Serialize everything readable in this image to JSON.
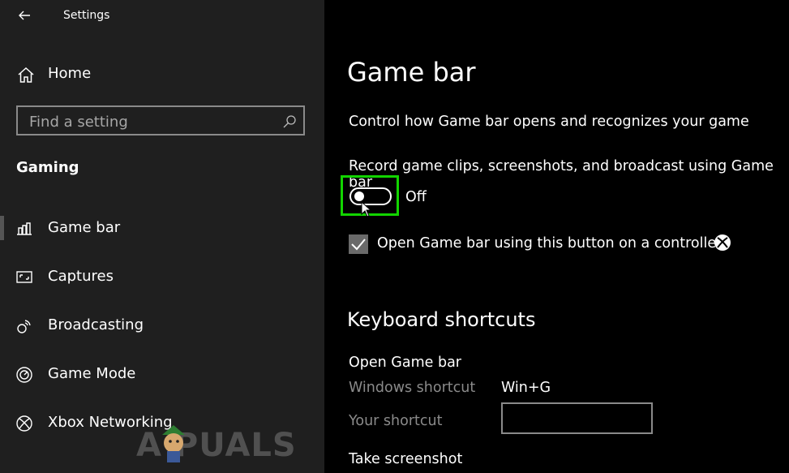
{
  "window": {
    "title": "Settings"
  },
  "sidebar": {
    "home_label": "Home",
    "search_placeholder": "Find a setting",
    "section_title": "Gaming",
    "items": [
      {
        "label": "Game bar",
        "icon": "game-bar-icon",
        "active": true
      },
      {
        "label": "Captures",
        "icon": "captures-icon",
        "active": false
      },
      {
        "label": "Broadcasting",
        "icon": "broadcasting-icon",
        "active": false
      },
      {
        "label": "Game Mode",
        "icon": "game-mode-icon",
        "active": false
      },
      {
        "label": "Xbox Networking",
        "icon": "xbox-icon",
        "active": false
      }
    ]
  },
  "main": {
    "title": "Game bar",
    "subtitle": "Control how Game bar opens and recognizes your game",
    "record_label": "Record game clips, screenshots, and broadcast using Game bar",
    "toggle_state": "Off",
    "controller_checkbox_label": "Open Game bar using this button on a controller:",
    "controller_checked": true,
    "shortcuts_title": "Keyboard shortcuts",
    "open_game_bar": "Open Game bar",
    "windows_shortcut_label": "Windows shortcut",
    "windows_shortcut_value": "Win+G",
    "your_shortcut_label": "Your shortcut",
    "your_shortcut_value": "",
    "take_screenshot": "Take screenshot"
  },
  "watermark": {
    "text": "A PUALS"
  },
  "colors": {
    "highlight": "#12d400",
    "sidebar_bg": "#1f1f1f",
    "main_bg": "#000000"
  }
}
